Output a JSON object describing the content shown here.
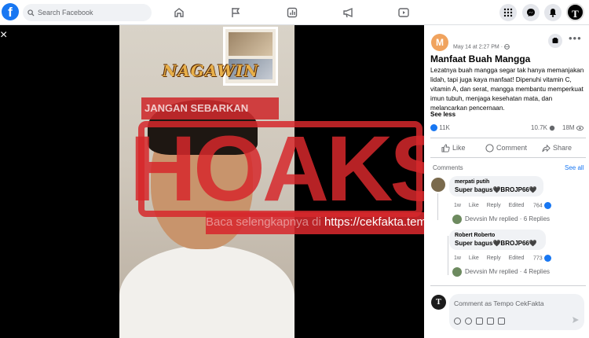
{
  "topbar": {
    "logo": "f",
    "search_placeholder": "Search Facebook",
    "nav_icons": [
      "home-icon",
      "flag-icon",
      "stats-icon",
      "megaphone-icon",
      "video-icon"
    ],
    "right_icons": [
      "menu-grid-icon",
      "messenger-icon",
      "bell-icon"
    ],
    "avatar_letter": "T"
  },
  "video": {
    "close": "×",
    "brand_logo": "NAGAWIN",
    "banner_text": "JANGAN SEBARKAN",
    "stamp_text": "HOAKS",
    "stamp_caption_faded": "Baca selengkapnya di",
    "stamp_caption_url": "https://cekfakta.tempo.co"
  },
  "post": {
    "page_avatar": "M",
    "meta": "May 14 at 2:27 PM · ",
    "title": "Manfaat Buah Mangga",
    "body": "Lezatnya buah mangga segar tak hanya memanjakan lidah, tapi juga kaya manfaat! Dipenuhi vitamin C, vitamin A, dan serat, mangga membantu memperkuat imun tubuh, menjaga kesehatan mata, dan melancarkan pencernaan.",
    "see_less": "See less",
    "reactions_count": "11K",
    "comments_count": "10.7K",
    "views_count": "18M",
    "actions": {
      "like": "Like",
      "comment": "Comment",
      "share": "Share"
    }
  },
  "comments": {
    "header": "Comments",
    "see_all": "See all",
    "items": [
      {
        "author": "merpati putih",
        "text": "Super bagus🖤BROJP66🖤",
        "time": "1w",
        "like": "Like",
        "reply": "Reply",
        "edited": "Edited",
        "reactions": "764",
        "replied_by": "Devvsin Mv replied · 6 Replies"
      },
      {
        "author": "Robert Roberto",
        "text": "Super bagus🖤BROJP66🖤",
        "time": "1w",
        "like": "Like",
        "reply": "Reply",
        "edited": "Edited",
        "reactions": "773",
        "replied_by": "Devvsin Mv replied · 4 Replies"
      }
    ]
  },
  "composer": {
    "avatar_letter": "T",
    "placeholder": "Comment as Tempo CekFakta"
  },
  "colors": {
    "brand_blue": "#1877f2",
    "hoax_red": "#d6282c",
    "panel_bg": "#ffffff",
    "video_bg": "#000000"
  }
}
